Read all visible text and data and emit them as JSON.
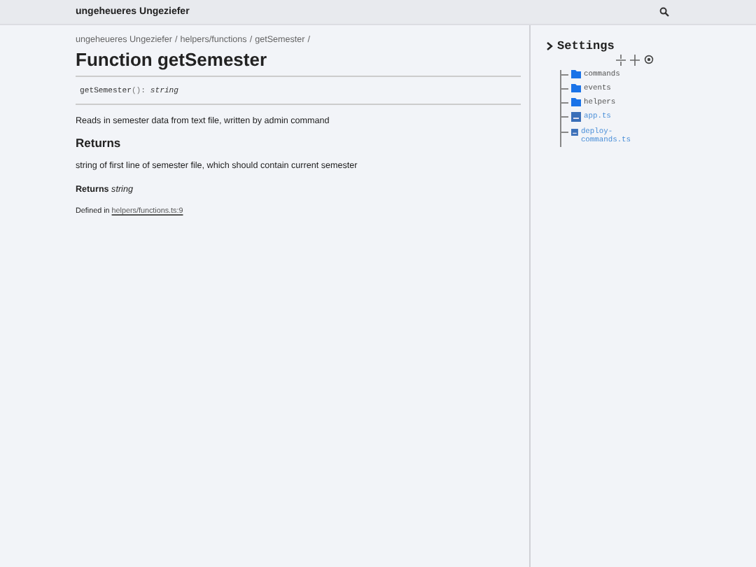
{
  "header": {
    "title": "ungeheueres Ungeziefer"
  },
  "breadcrumbs": [
    {
      "label": "ungeheueres Ungeziefer",
      "separator": "/"
    },
    {
      "label": "helpers/functions",
      "separator": "/"
    },
    {
      "label": "getSemester",
      "separator": "/"
    }
  ],
  "title": "Function getSemester",
  "signature": {
    "name": "getSemester",
    "params": "():",
    "type": "string"
  },
  "description": "Reads in semester data from text file, written by admin command",
  "returns_heading": "Returns",
  "returns_text": "string of first line of semester file, which should contain current semester",
  "returns_label": "Returns",
  "returns_type": "string",
  "defined": {
    "prefix": "Defined in",
    "link": "helpers/functions.ts:9"
  },
  "settings": {
    "label": "Settings",
    "expanded": false
  },
  "tree": [
    {
      "kind": "folder",
      "label": "commands"
    },
    {
      "kind": "folder",
      "label": "events"
    },
    {
      "kind": "folder",
      "label": "helpers"
    },
    {
      "kind": "file",
      "label": "app.ts"
    },
    {
      "kind": "file",
      "label": "deploy-commands.ts"
    }
  ]
}
